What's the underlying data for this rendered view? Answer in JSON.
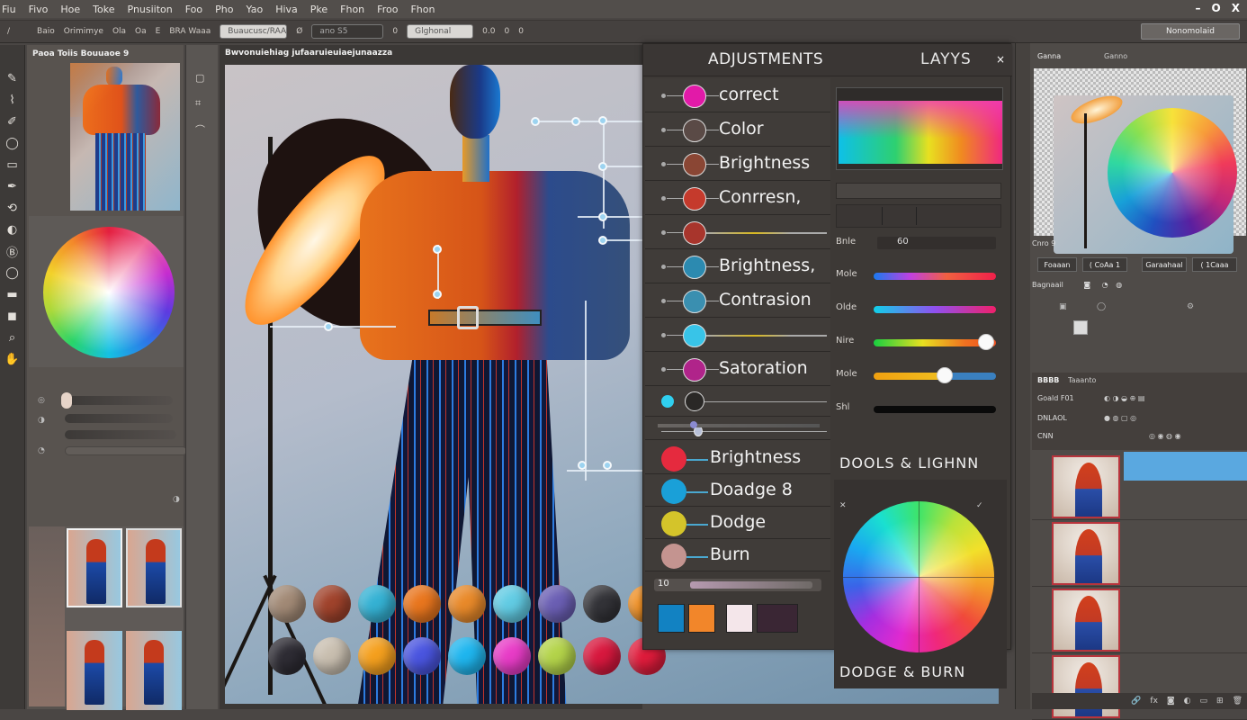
{
  "menubar": {
    "items": [
      "Fiu",
      "Fivo",
      "Hoe",
      "Toke",
      "Pnusiiton",
      "Foo",
      "Pho",
      "Yao",
      "Hiva",
      "Pke",
      "Fhon",
      "Froo",
      "Fhon"
    ],
    "window_controls": {
      "minimize": "–",
      "maximize": "O",
      "close": "X"
    }
  },
  "optionsbar": {
    "items": [
      "/",
      "Baio",
      "Orimimye",
      "Ola",
      "Oa",
      "E",
      "BRA Waaa"
    ],
    "field1": "Buaucusc/RAA",
    "field1_suffix": "Ø",
    "field2": "ano S5",
    "field2_suffix": "0",
    "field3": "Glghonal",
    "trail": [
      "0.0",
      "0",
      "0"
    ],
    "right_button": "Nonomolaid"
  },
  "toolbar": {
    "tools": [
      "move-tool",
      "lasso-tool",
      "brush-tool",
      "ellipse-tool",
      "marquee-tool",
      "pen-tool",
      "crop-tool",
      "dodge-tool",
      "type-tool",
      "shape-tool",
      "eraser-tool",
      "fill-tool",
      "zoom-tool",
      "hand-tool"
    ],
    "glyphs": [
      "✎",
      "⌇",
      "✐",
      "◯",
      "▭",
      "✒",
      "⟲",
      "◐",
      "Ⓑ",
      "◯",
      "▬",
      "◼",
      "⌕",
      "✋"
    ]
  },
  "left_panel": {
    "title": "Paoa Toiis Bouuaoe 9",
    "slider_icons": [
      "◎",
      "◑",
      "◔",
      "◑"
    ]
  },
  "strip": {
    "icons": [
      "▢",
      "⌗",
      "⌒"
    ]
  },
  "canvas": {
    "title": "Bwvonuiehiag jufaaruieuiaejunaazza",
    "spheres_row1": [
      "#a28a76",
      "#a0432c",
      "#35b2d4",
      "#e9761e",
      "#e98a2a",
      "#62cce4",
      "#6b5fb4",
      "#333338",
      "#f09024"
    ],
    "spheres_row2": [
      "#2e2c34",
      "#c9bfb0",
      "#f5a01e",
      "#4a55e0",
      "#1fb6ef",
      "#e83cc7",
      "#b4d44a",
      "#d8183e",
      "#e01c3c"
    ]
  },
  "adjustments": {
    "tab_active": "ADJUSTMENTS",
    "tab_inactive": "LAYYS",
    "close": "×",
    "rows": [
      {
        "label": "correct",
        "color": "#e21aa8"
      },
      {
        "label": "Color",
        "color": "#5a4a46"
      },
      {
        "label": "Brightness",
        "color": "#8a4634"
      },
      {
        "label": "Conrresn,",
        "color": "#c53a2c"
      },
      {
        "label": "",
        "color": "#a8352c"
      },
      {
        "label": "Brightness,",
        "color": "#2c8ab0"
      },
      {
        "label": "Contrasion",
        "color": "#3a8fb0"
      },
      {
        "label": "",
        "color": "#38c4e8"
      },
      {
        "label": "Satoration",
        "color": "#b0248a"
      }
    ],
    "lower_rows": [
      {
        "label": "Brightness",
        "color": "#e52a3e"
      },
      {
        "label": "Doadge 8",
        "color": "#1aa0d8"
      },
      {
        "label": "Dodge",
        "color": "#d4c42a"
      },
      {
        "label": "Burn",
        "color": "#c49490"
      }
    ],
    "opacity_value": "10",
    "swatches": [
      "#1282c2",
      "#f2862a",
      "#f4e6ea",
      "#3a2634"
    ],
    "right": {
      "field_label": "Bnle",
      "field_value": "60",
      "sliders": [
        {
          "label": "Mole",
          "value": null
        },
        {
          "label": "Olde",
          "value": null
        },
        {
          "label": "Nire",
          "value": 0.92
        },
        {
          "label": "Mole",
          "value": 0.58
        },
        {
          "label": "Shl",
          "value": null
        }
      ],
      "tools_title": "DOOLS & LIGHNN",
      "dodge_title": "DODGE & BURN"
    }
  },
  "right_panel": {
    "nav_tab": "Ganna",
    "nav_tab2": "Ganno",
    "info_label": "Cnro 9",
    "buttons": [
      "Foaaan",
      "( CoAa 1",
      "Garaahaal",
      "( 1Caaa"
    ],
    "row_label": "Bagnaail",
    "layers_tabs": [
      "BBBB",
      "Taaanto"
    ],
    "layers_rows": [
      "Goald F01",
      "DNLAOL",
      "CNN"
    ],
    "layers_count": 4
  }
}
